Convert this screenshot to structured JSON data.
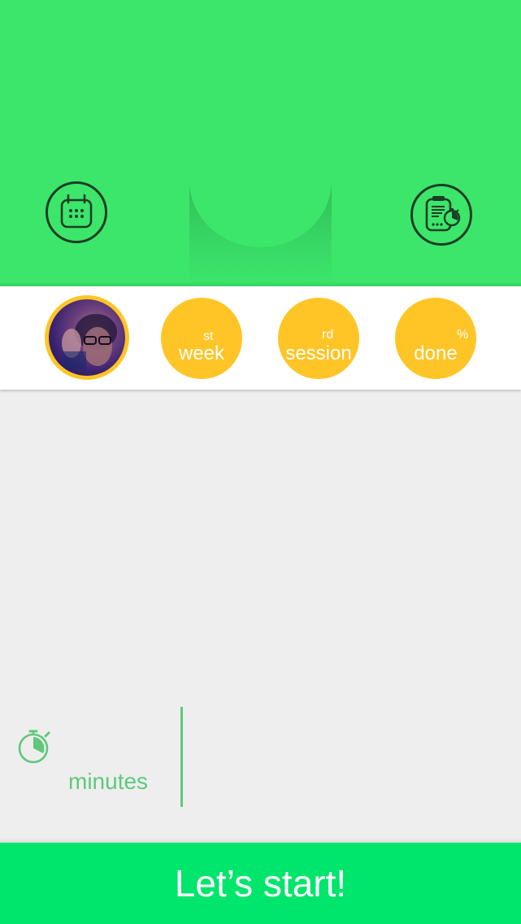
{
  "header": {
    "calendar_button_icon": "calendar-icon",
    "plan_button_icon": "clipboard-timer-icon",
    "accent": "#3ce66b",
    "icon_color": "#1d3d26"
  },
  "stats": {
    "avatar_icon": "user-avatar-photo",
    "week": {
      "suffix": "st",
      "label": "week"
    },
    "session": {
      "suffix": "rd",
      "label": "session"
    },
    "done": {
      "suffix": "%",
      "label": "done"
    },
    "circle_color": "#ffc526"
  },
  "timer": {
    "icon": "stopwatch-icon",
    "unit_label": "minutes",
    "color": "#5ec97a"
  },
  "start_button": {
    "label": "Let’s start!",
    "color": "#00e56b"
  }
}
